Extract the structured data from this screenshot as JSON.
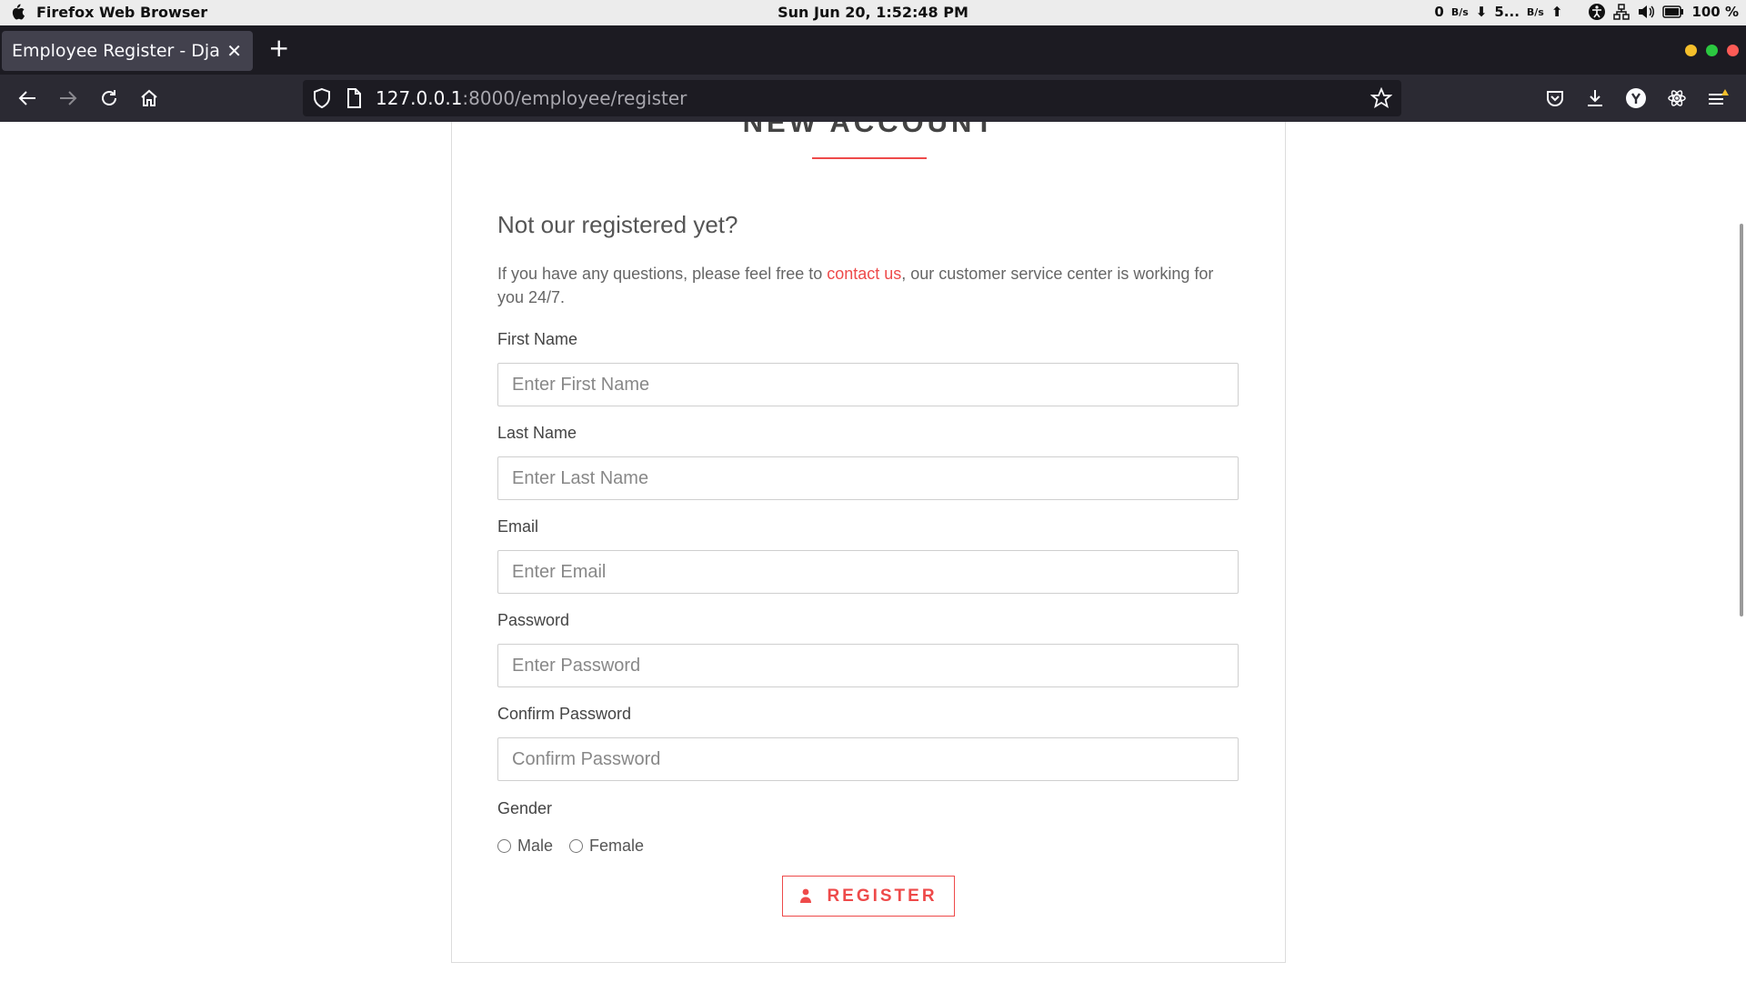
{
  "os_bar": {
    "app_name": "Firefox Web Browser",
    "clock": "Sun Jun 20,  1:52:48 PM",
    "net_down_value": "0",
    "net_down_unit": "B/s",
    "net_up_value": "5...",
    "net_up_unit": "B/s",
    "battery": "100 %"
  },
  "browser": {
    "tab_title": "Employee Register - Django",
    "url_host": "127.0.0.1",
    "url_path": ":8000/employee/register"
  },
  "page": {
    "title": "NEW ACCOUNT",
    "subtitle": "Not our registered yet?",
    "intro_before": "If you have any questions, please feel free to ",
    "intro_link": "contact us",
    "intro_after": ", our customer service center is working for you 24/7.",
    "fields": [
      {
        "label": "First Name",
        "placeholder": "Enter First Name"
      },
      {
        "label": "Last Name",
        "placeholder": "Enter Last Name"
      },
      {
        "label": "Email",
        "placeholder": "Enter Email"
      },
      {
        "label": "Password",
        "placeholder": "Enter Password"
      },
      {
        "label": "Confirm Password",
        "placeholder": "Confirm Password"
      }
    ],
    "gender_label": "Gender",
    "gender_options": [
      "Male",
      "Female"
    ],
    "register_label": "REGISTER",
    "accent_color": "#ee4a4a"
  }
}
